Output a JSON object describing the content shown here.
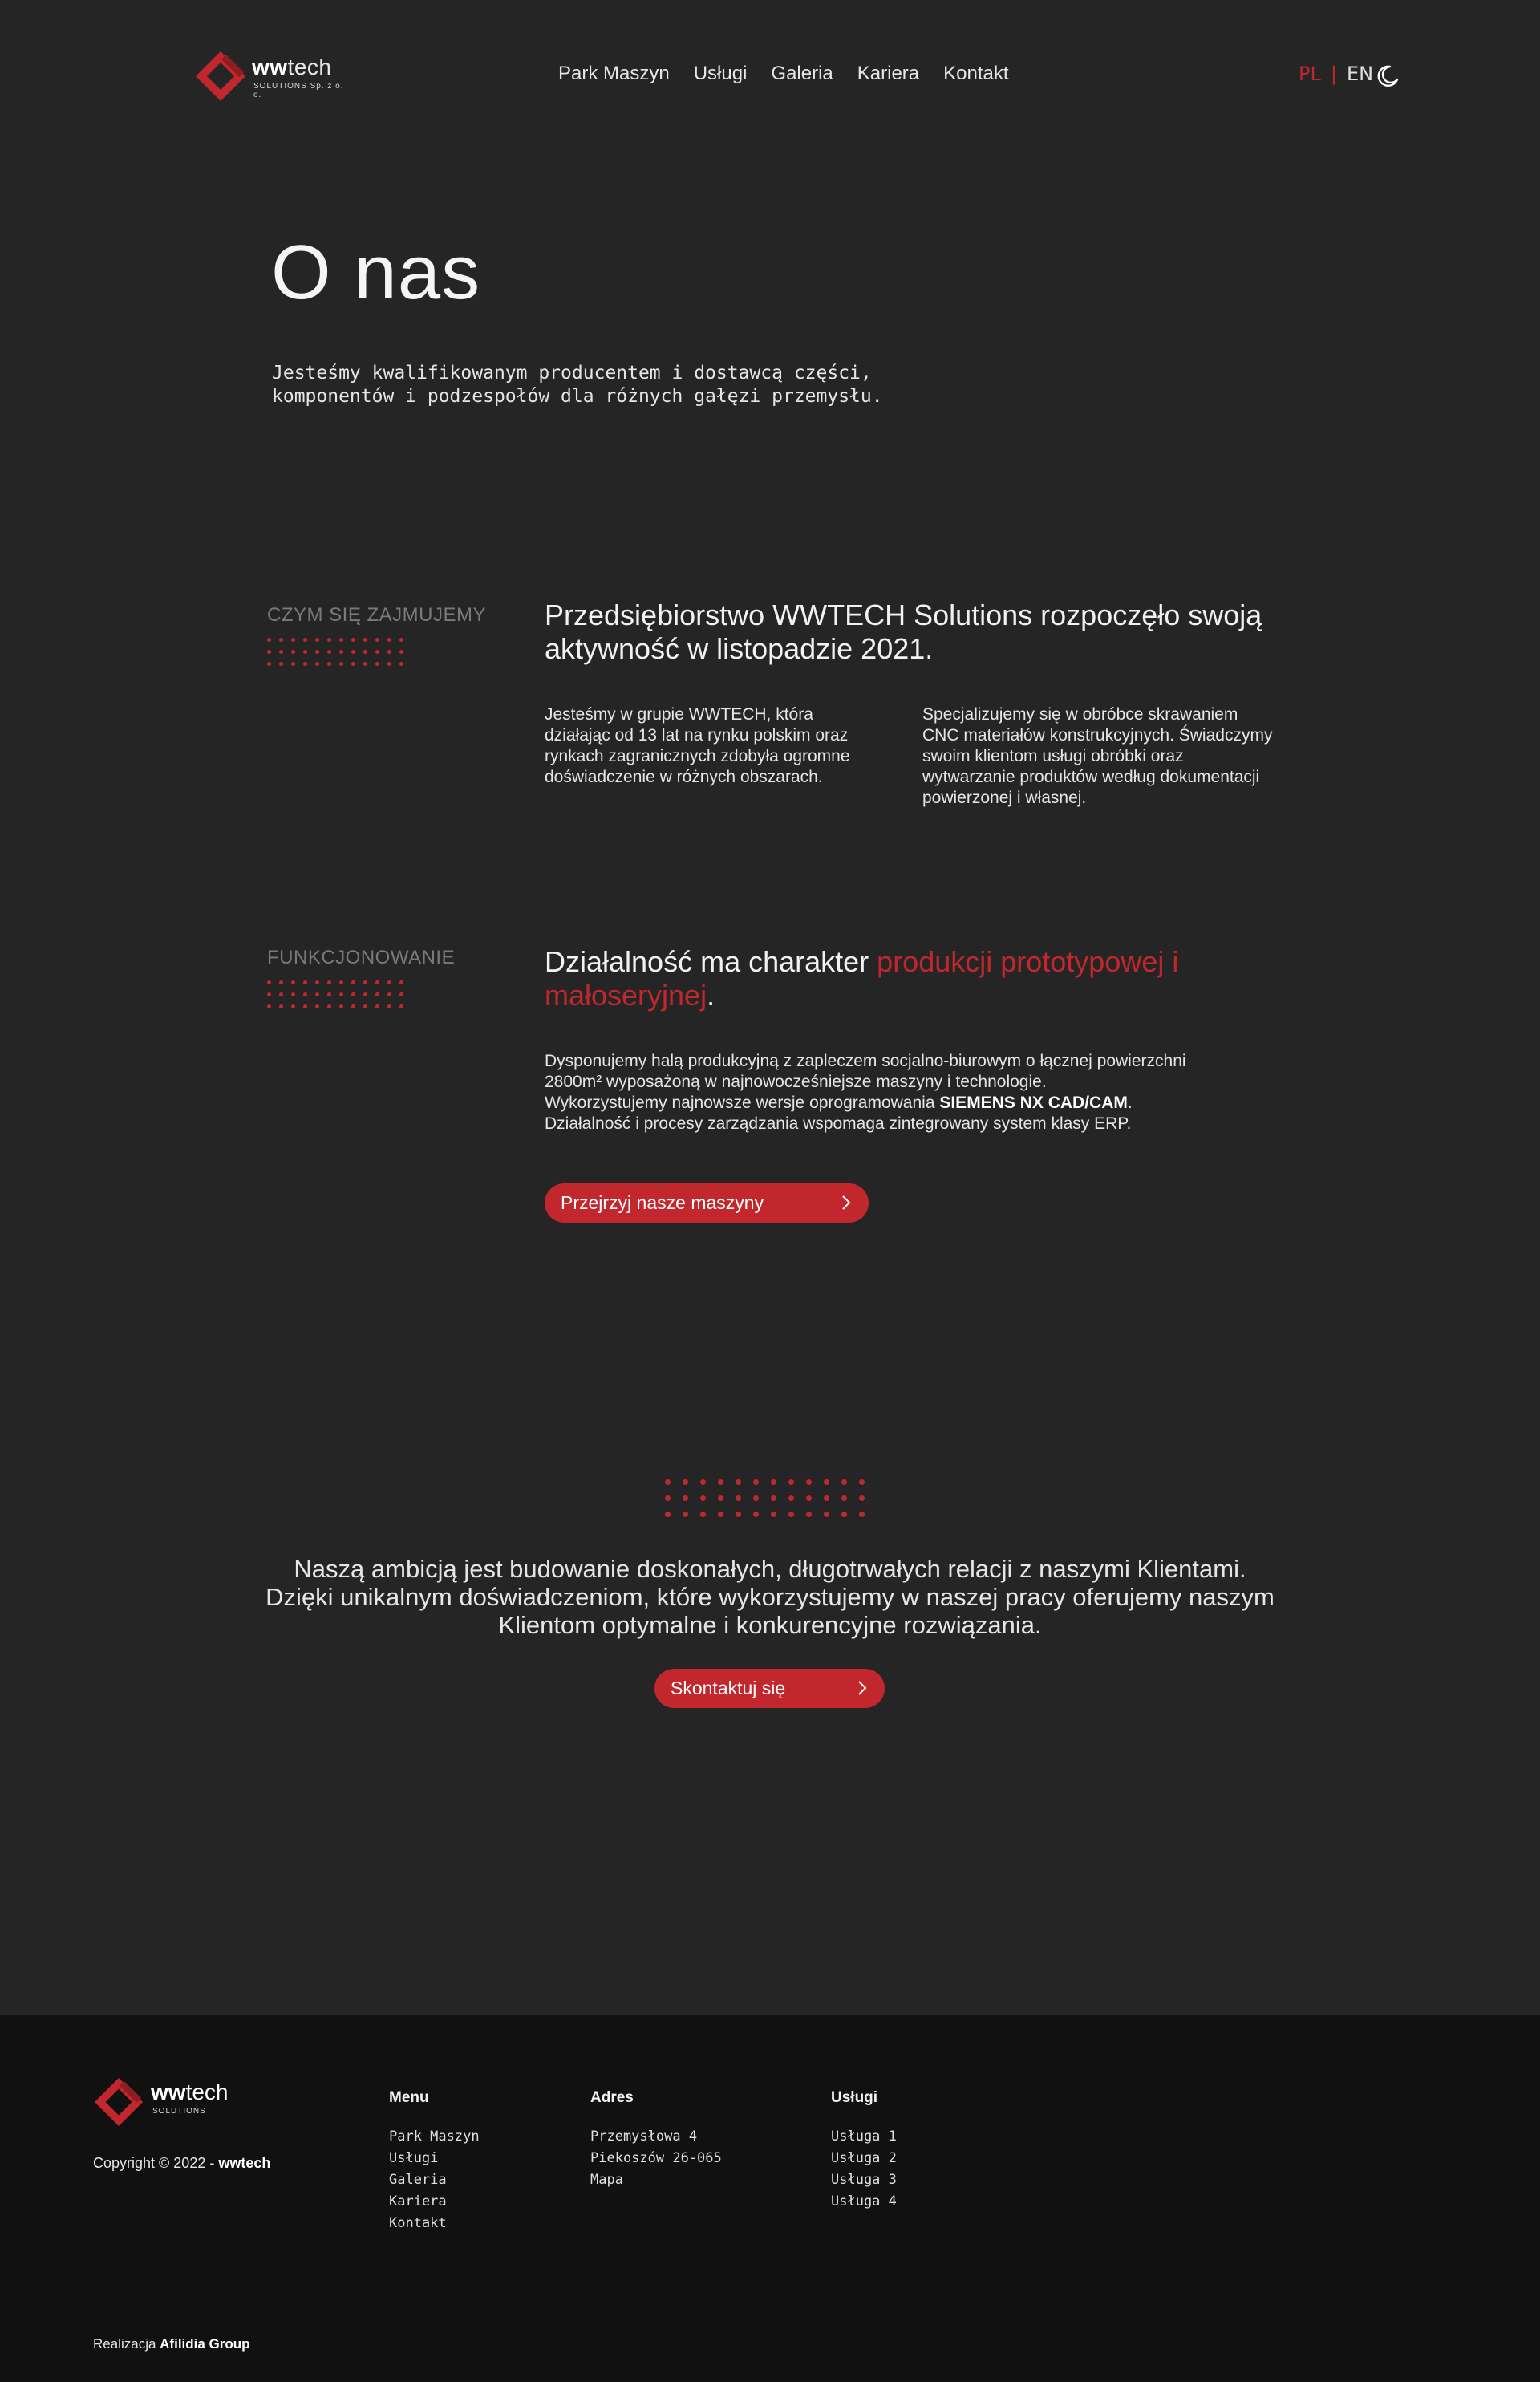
{
  "header": {
    "logo": {
      "brand_bold": "ww",
      "brand_rest": "tech",
      "subtitle": "SOLUTIONS  Sp. z o. o."
    },
    "nav": [
      "Park Maszyn",
      "Usługi",
      "Galeria",
      "Kariera",
      "Kontakt"
    ],
    "lang": {
      "active": "PL",
      "separator": "|",
      "other": "EN"
    },
    "theme_icon": "moon-icon"
  },
  "hero": {
    "title": "O nas",
    "description": "Jesteśmy kwalifikowanym producentem i dostawcą części, komponentów i podzespołów dla różnych gałęzi przemysłu."
  },
  "section1": {
    "label": "CZYM SIĘ ZAJMUJEMY",
    "title": "Przedsiębiorstwo WWTECH Solutions rozpoczęło swoją aktywność w listopadzie 2021.",
    "col1": "Jesteśmy w grupie WWTECH, która działając od 13 lat na rynku polskim oraz rynkach zagranicznych zdobyła ogromne doświadczenie w różnych obszarach.",
    "col2": "Specjalizujemy się w obróbce skrawaniem CNC materiałów konstrukcyjnych. Świadczymy swoim klientom usługi obróbki oraz wytwarzanie produktów według dokumentacji powierzonej i własnej."
  },
  "section2": {
    "label": "FUNKCJONOWANIE",
    "title_plain": "Działalność ma charakter ",
    "title_highlight": "produkcji prototypowej i małoseryjnej",
    "title_end": ".",
    "body_line1": "Dysponujemy halą produkcyjną z zapleczem socjalno-biurowym o łącznej powierzchni 2800m² wyposażoną w najnowocześniejsze maszyny i technologie.",
    "body_line2_pre": "Wykorzystujemy najnowsze wersje oprogramowania ",
    "body_line2_bold": "SIEMENS NX CAD/CAM",
    "body_line2_post": ".",
    "body_line3": "Działalność i procesy zarządzania wspomaga zintegrowany system klasy ERP.",
    "button": "Przejrzyj nasze maszyny"
  },
  "ambition": {
    "text": "Naszą ambicją jest budowanie doskonałych, długotrwałych relacji z naszymi Klientami. Dzięki unikalnym doświadczeniom, które wykorzystujemy w naszej pracy oferujemy naszym Klientom optymalne i konkurencyjne rozwiązania.",
    "button": "Skontaktuj się"
  },
  "footer": {
    "logo": {
      "brand_bold": "ww",
      "brand_rest": "tech",
      "subtitle": "SOLUTIONS"
    },
    "copyright_pre": "Copyright © 2022 - ",
    "copyright_brand": "wwtech",
    "menu": {
      "title": "Menu",
      "items": [
        "Park Maszyn",
        "Usługi",
        "Galeria",
        "Kariera",
        "Kontakt"
      ]
    },
    "address": {
      "title": "Adres",
      "items": [
        "Przemysłowa 4",
        "Piekoszów 26-065",
        "Mapa"
      ]
    },
    "services": {
      "title": "Usługi",
      "items": [
        "Usługa 1",
        "Usługa 2",
        "Usługa 3",
        "Usługa 4"
      ]
    },
    "realizacja_pre": "Realizacja ",
    "realizacja_brand": "Afilidia Group"
  },
  "colors": {
    "accent": "#c1272d",
    "background": "#252525",
    "footer_bg": "#111111"
  }
}
